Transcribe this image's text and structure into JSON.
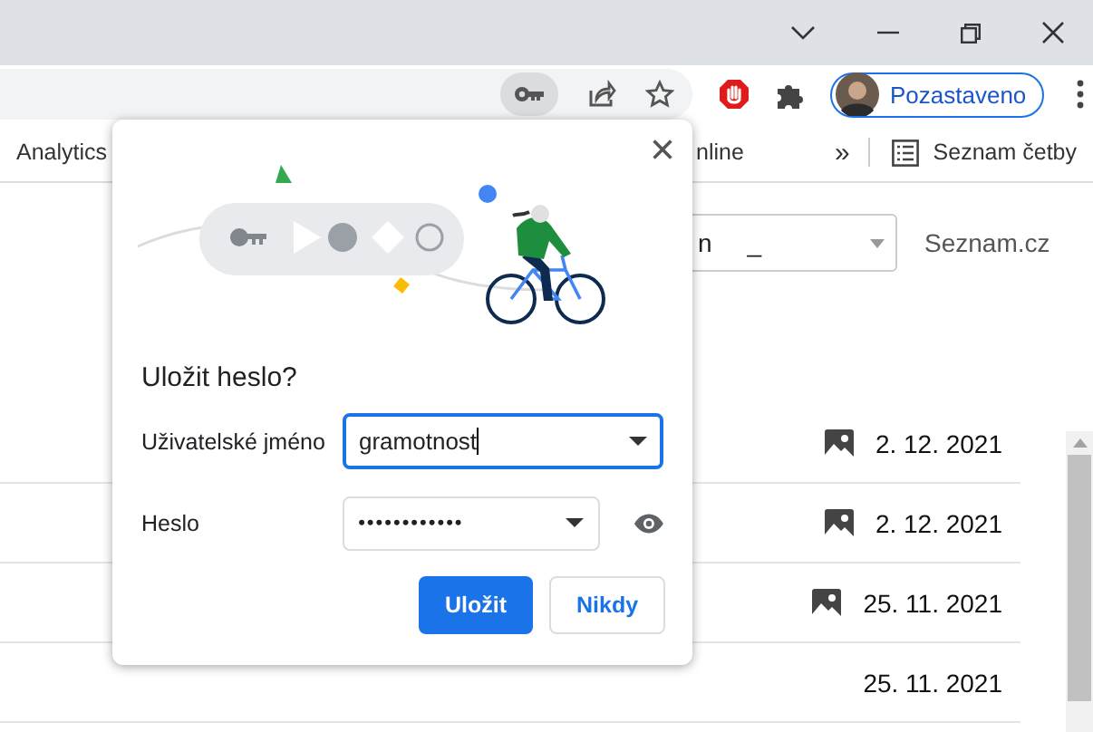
{
  "toolbar": {
    "password_icon": {
      "selected": true
    },
    "profile": {
      "label": "Pozastaveno"
    }
  },
  "bookmarks": {
    "items": [
      {
        "label": "Analytics"
      },
      {
        "label": "nline"
      }
    ],
    "overflow": "»",
    "reading_list": "Seznam četby"
  },
  "page": {
    "select": {
      "value": "n     _"
    },
    "site_label": "Seznam.cz",
    "rows": [
      {
        "date": "2. 12. 2021",
        "has_image": true
      },
      {
        "date": "2. 12. 2021",
        "has_image": true
      },
      {
        "date": "25. 11. 2021",
        "has_image": true
      },
      {
        "date": "25. 11. 2021",
        "has_image": false
      }
    ]
  },
  "dialog": {
    "title": "Uložit heslo?",
    "fields": [
      {
        "kind": "text",
        "label": "Uživatelské jméno",
        "value": "gramotnost",
        "focused": true
      },
      {
        "kind": "password",
        "label": "Heslo",
        "value": "••••••••••••",
        "focused": false
      }
    ],
    "buttons": [
      {
        "kind": "primary",
        "label": "Uložit"
      },
      {
        "kind": "secondary",
        "label": "Nikdy"
      }
    ]
  }
}
